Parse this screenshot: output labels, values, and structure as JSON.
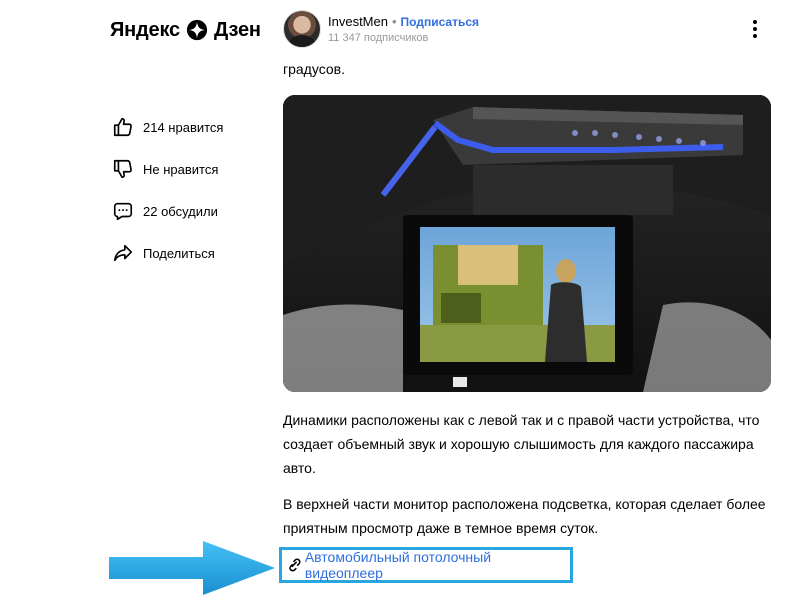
{
  "header": {
    "logo_text": "Яндекс Дзен",
    "channel_name": "InvestMen",
    "separator": "•",
    "subscribe_label": "Подписаться",
    "subscribers": "11 347 подписчиков"
  },
  "actions": {
    "like": "214 нравится",
    "dislike": "Не нравится",
    "comments": "22 обсудили",
    "share": "Поделиться"
  },
  "article": {
    "top_text": "градусов.",
    "paragraph1": "Динамики расположены как с левой так и с правой части устройства, что создает объемный звук и хорошую слышимость для каждого пассажира авто.",
    "paragraph2": "В верхней части монитор расположена подсветка, которая сделает более приятным просмотр даже в темное время суток.",
    "link_text": "Автомобильный потолочный видеоплеер"
  },
  "colors": {
    "accent_blue": "#2f6fdf",
    "highlight_box": "#27a6e0",
    "arrow": "#2aa7e2"
  }
}
